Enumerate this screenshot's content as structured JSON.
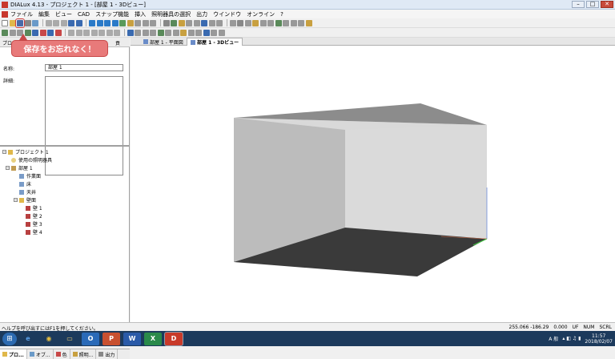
{
  "window": {
    "title": "DIALux 4.13 - プロジェクト 1 - [部屋 1 - 3Dビュー]",
    "controls": [
      "–",
      "□",
      "✕"
    ]
  },
  "menu": [
    "ファイル",
    "編集",
    "ビュー",
    "CAD",
    "スナップ機能",
    "挿入",
    "照明器具の選択",
    "出力",
    "ウインドウ",
    "オンライン",
    "?"
  ],
  "callout": {
    "text": "保存をお忘れなく！"
  },
  "left_panel": {
    "tab_left": "プロ",
    "tab_right": "貢",
    "name_label": "名称:",
    "name_value": "部屋 1",
    "detail_label": "詳細:"
  },
  "tree": {
    "project": "プロジェクト 1",
    "luminaires_used": "使用の照明器具",
    "room": "部屋 1",
    "workplane": "作業面",
    "floor": "床",
    "ceiling": "天井",
    "walls_folder": "壁面",
    "walls": [
      "壁 1",
      "壁 2",
      "壁 3",
      "壁 4"
    ]
  },
  "bottom_tabs": [
    "プロ...",
    "オブ...",
    "色",
    "照明...",
    "出力"
  ],
  "doc_tabs": [
    "部屋 1 - 平面図",
    "部屋 1 - 3Dビュー"
  ],
  "status": {
    "help": "ヘルプを呼び出すにはF1を押してください。",
    "coords": "255.066 -186.29",
    "zero": "0.000",
    "unit": "UF",
    "num": "NUM",
    "scrl": "SCRL"
  },
  "taskbar": {
    "ime": "A 般",
    "time": "11:57",
    "date": "2018/02/07",
    "apps": [
      "e",
      "◉",
      "▭",
      "O",
      "P",
      "W",
      "X",
      "D"
    ]
  },
  "colors": {
    "accent_red": "#cf3a3a",
    "callout_bg": "#e87a7a",
    "floor": "#3a3a3a",
    "ceiling": "#8c8c8c",
    "left_wall": "#bcbcbc",
    "back_wall": "#d9d9d9"
  }
}
